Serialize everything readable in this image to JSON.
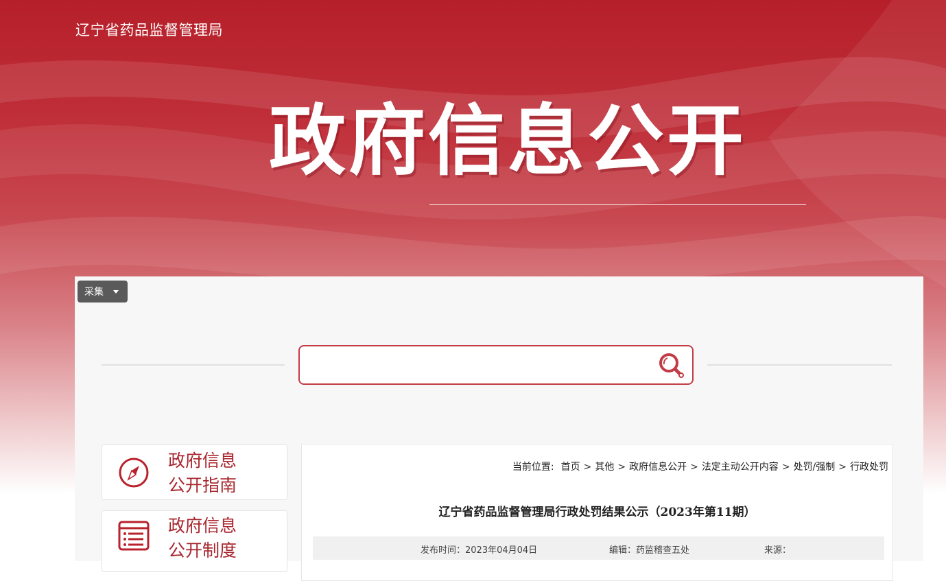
{
  "header": {
    "site_name": "辽宁省药品监督管理局",
    "hero_title": "政府信息公开"
  },
  "toolbar": {
    "collect_label": "采集"
  },
  "search": {
    "value": "",
    "placeholder": ""
  },
  "sidebar": {
    "items": [
      {
        "line1": "政府信息",
        "line2": "公开指南",
        "icon": "compass-icon"
      },
      {
        "line1": "政府信息",
        "line2": "公开制度",
        "icon": "list-document-icon"
      }
    ]
  },
  "breadcrumb": {
    "prefix": "当前位置:",
    "items": [
      "首页",
      "其他",
      "政府信息公开",
      "法定主动公开内容",
      "处罚/强制",
      "行政处罚"
    ],
    "separator": ">"
  },
  "article": {
    "title": "辽宁省药品监督管理局行政处罚结果公示（2023年第11期）",
    "publish_time": "发布时间：2023年04月04日",
    "editor": "编辑：药监稽查五处",
    "source": "来源："
  },
  "colors": {
    "brand_red": "#b61f29",
    "accent_red": "#c33c45",
    "label_red": "#a8272f"
  }
}
